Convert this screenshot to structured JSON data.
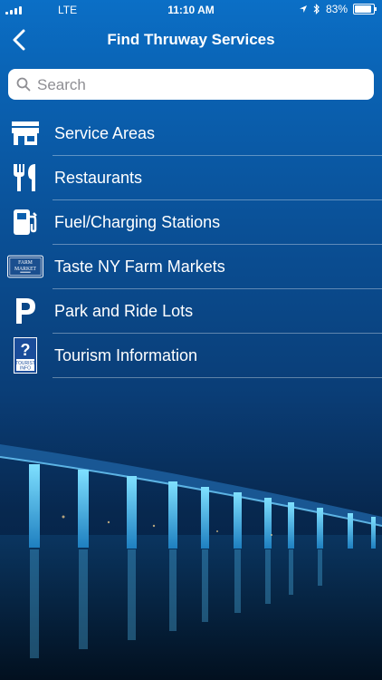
{
  "status_bar": {
    "carrier": "LTE",
    "time": "11:10 AM",
    "battery": "83%"
  },
  "header": {
    "title": "Find Thruway Services"
  },
  "search": {
    "placeholder": "Search"
  },
  "menu": {
    "items": [
      {
        "label": "Service Areas",
        "icon": "store-icon"
      },
      {
        "label": "Restaurants",
        "icon": "fork-knife-icon"
      },
      {
        "label": "Fuel/Charging Stations",
        "icon": "fuel-pump-icon"
      },
      {
        "label": "Taste NY Farm Markets",
        "icon": "farm-market-icon"
      },
      {
        "label": "Park and Ride Lots",
        "icon": "parking-icon"
      },
      {
        "label": "Tourism Information",
        "icon": "tourist-info-icon"
      }
    ]
  },
  "icons": {
    "farm_market_top": "FARM",
    "farm_market_bottom": "MARKET",
    "tourist_line1": "TOURIST",
    "tourist_line2": "INFO"
  },
  "colors": {
    "background_top": "#0b6fc6",
    "background_bottom": "#041a36",
    "bridge_light": "#5fd0ff"
  }
}
